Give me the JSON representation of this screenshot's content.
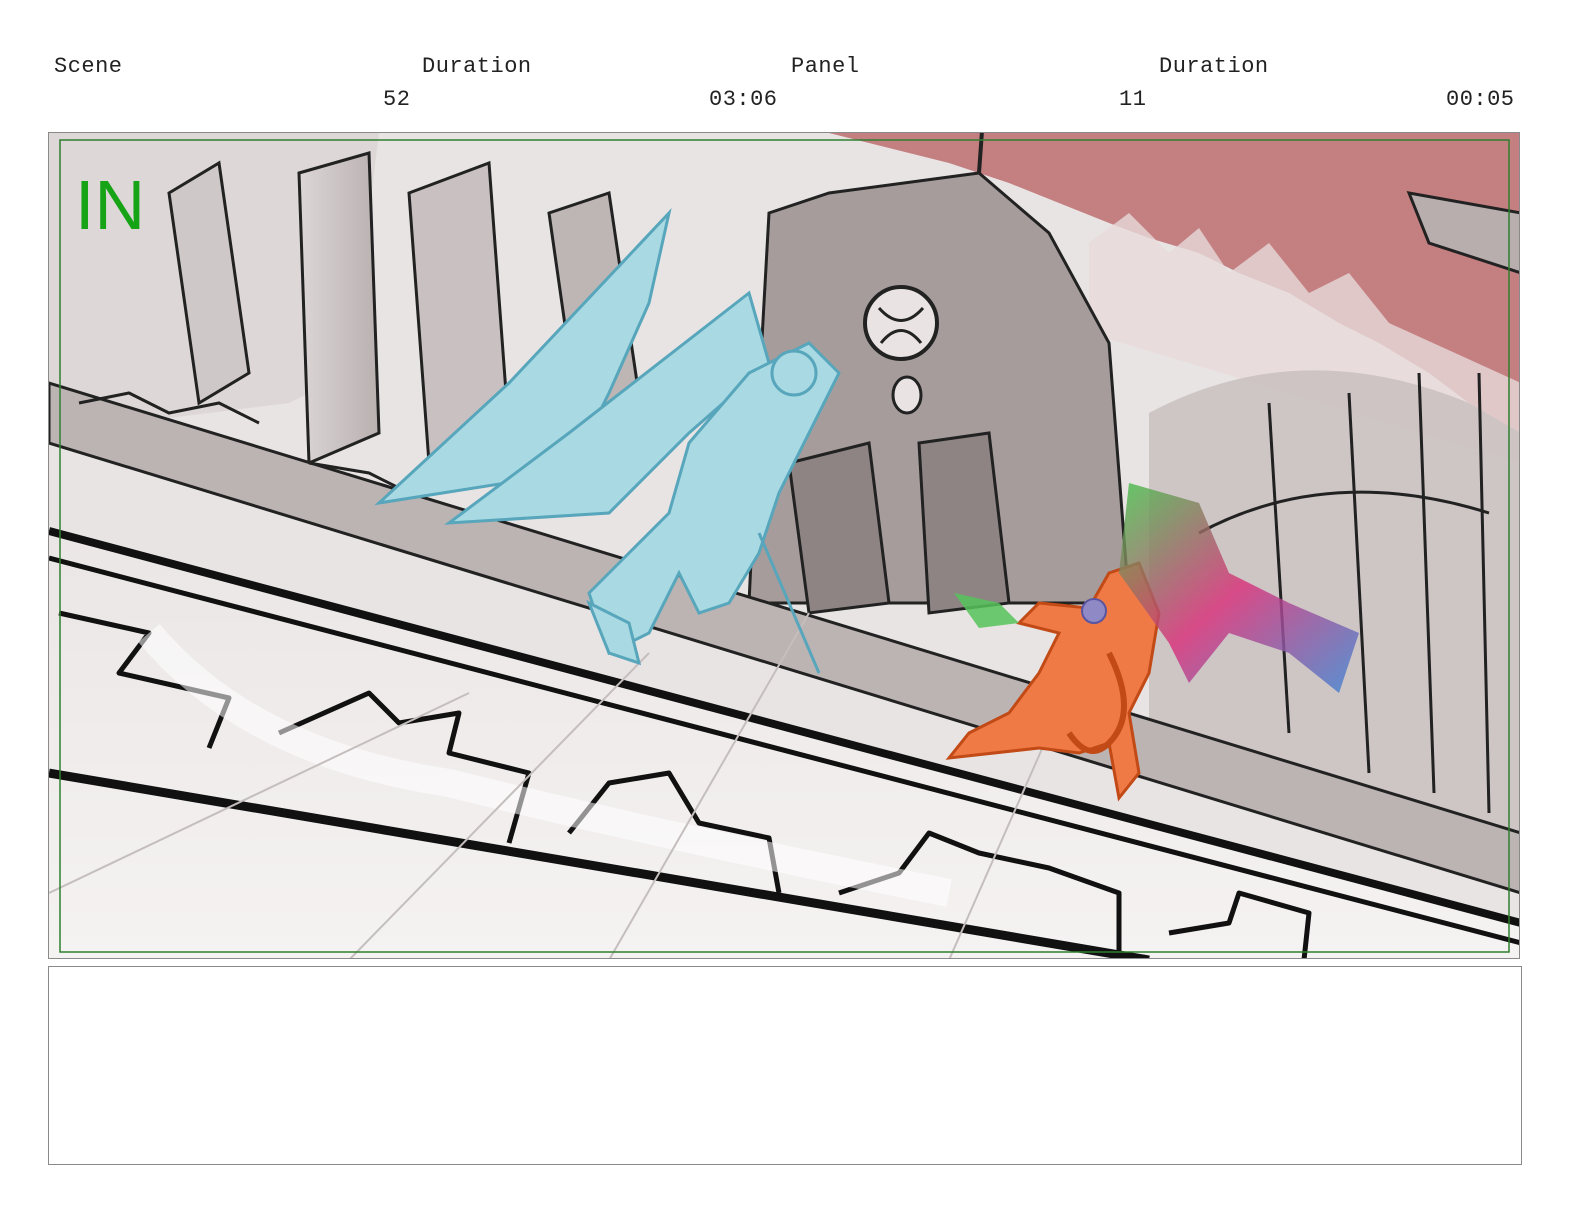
{
  "header": {
    "scene_label": "Scene",
    "scene_duration_label": "Duration",
    "panel_label": "Panel",
    "panel_duration_label": "Duration",
    "scene_value": "52",
    "scene_duration_value": "03:06",
    "panel_value": "11",
    "panel_duration_value": "00:05"
  },
  "panel": {
    "transition_marker": "IN",
    "marker_color": "#16a316",
    "safe_frame_color": "#2f7f2f",
    "sky_color": "#c47f80"
  },
  "notes": {
    "text": ""
  }
}
